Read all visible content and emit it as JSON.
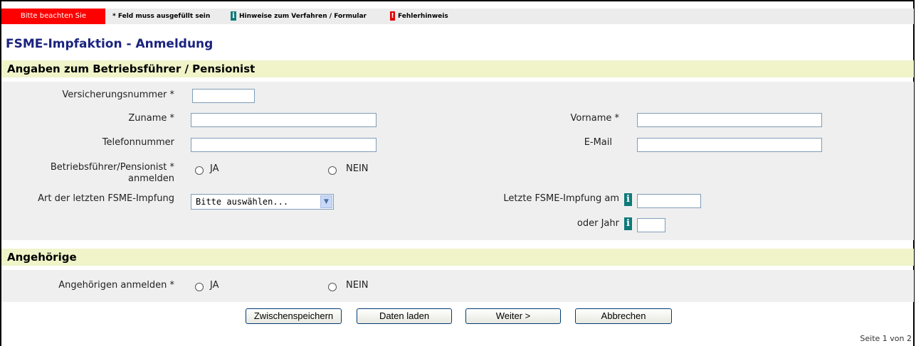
{
  "legend": {
    "hint": "Bitte beachten Sie",
    "required": "* Feld muss ausgefüllt sein",
    "info": "Hinweise zum Verfahren / Formular",
    "error": "Fehlerhinweis",
    "info_badge": "i",
    "error_badge": "!"
  },
  "page_title": "FSME-Impfaktion - Anmeldung",
  "section1": {
    "title": "Angaben zum Betriebsführer / Pensionist",
    "versicherungsnummer_label": "Versicherungsnummer *",
    "zuname_label": "Zuname *",
    "vorname_label": "Vorname *",
    "telefon_label": "Telefonnummer",
    "email_label": "E-Mail",
    "anmelden_label": "Betriebsführer/Pensionist * anmelden",
    "ja_label": "JA",
    "nein_label": "NEIN",
    "impfart_label": "Art der letzten FSME-Impfung",
    "impfart_value": "Bitte auswählen...",
    "letzte_label": "Letzte FSME-Impfung am",
    "jahr_label": "oder Jahr",
    "info_icon": "i"
  },
  "section2": {
    "title": "Angehörige",
    "anmelden_label": "Angehörigen anmelden *",
    "ja_label": "JA",
    "nein_label": "NEIN"
  },
  "buttons": {
    "save": "Zwischenspeichern",
    "load": "Daten laden",
    "next": "Weiter >",
    "cancel": "Abbrechen"
  },
  "page_number": "Seite 1 von 2",
  "colors": {
    "hint_bg": "#ff0000",
    "section_header_bg": "#f0f4c8",
    "section_body_bg": "#efefef",
    "info_icon": "#0f7a7a",
    "title": "#1a237e"
  }
}
